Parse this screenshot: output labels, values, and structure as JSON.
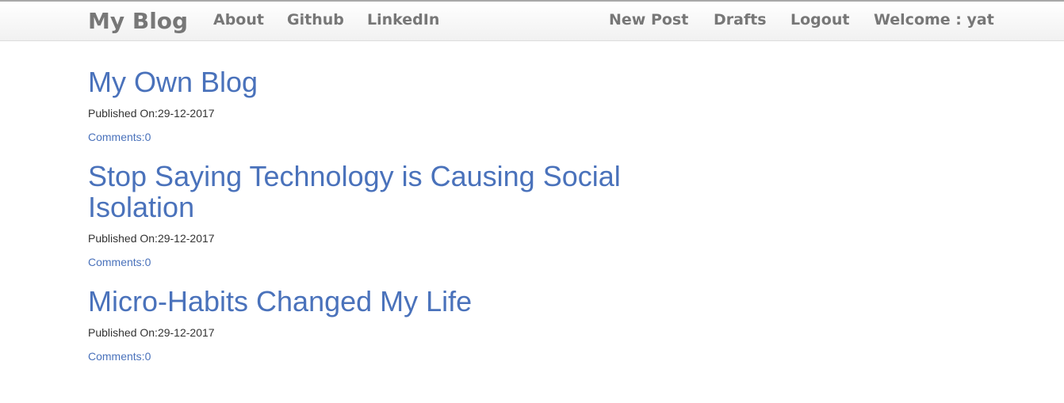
{
  "navbar": {
    "brand": "My Blog",
    "left_links": [
      "About",
      "Github",
      "LinkedIn"
    ],
    "right_links": [
      "New Post",
      "Drafts",
      "Logout",
      "Welcome : yat"
    ]
  },
  "posts": [
    {
      "title": "My Own Blog",
      "published": "Published On:29-12-2017",
      "comments": "Comments:0"
    },
    {
      "title": "Stop Saying Technology is Causing Social Isolation",
      "published": "Published On:29-12-2017",
      "comments": "Comments:0"
    },
    {
      "title": "Micro-Habits Changed My Life",
      "published": "Published On:29-12-2017",
      "comments": "Comments:0"
    }
  ]
}
